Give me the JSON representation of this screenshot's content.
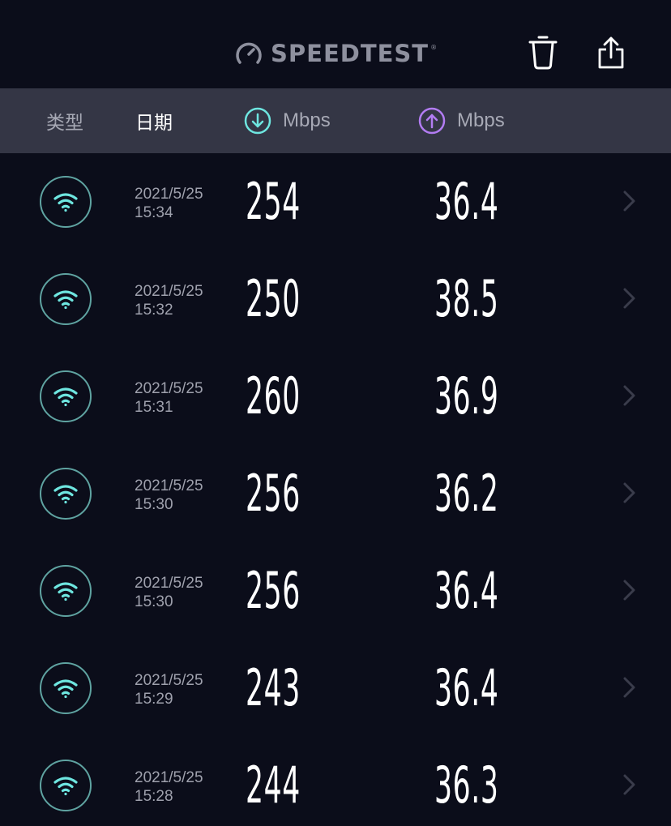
{
  "app": {
    "brand": "SPEEDTEST",
    "brand_tm": "®"
  },
  "header": {
    "type_label": "类型",
    "date_label": "日期",
    "download_unit": "Mbps",
    "upload_unit": "Mbps"
  },
  "icons": {
    "brand": "speedometer-icon",
    "trash": "trash-icon",
    "share": "share-icon",
    "download": "arrow-down-circle-icon",
    "upload": "arrow-up-circle-icon",
    "row_type": "wifi-icon",
    "row_chevron": "chevron-right-icon"
  },
  "colors": {
    "background": "#0b0d1a",
    "header_bg": "#343645",
    "download_accent": "#6ee6e0",
    "upload_accent": "#b27cf2",
    "wifi_circle": "#5fa3a1"
  },
  "results": [
    {
      "date": "2021/5/25",
      "time": "15:34",
      "download": "254",
      "upload": "36.4"
    },
    {
      "date": "2021/5/25",
      "time": "15:32",
      "download": "250",
      "upload": "38.5"
    },
    {
      "date": "2021/5/25",
      "time": "15:31",
      "download": "260",
      "upload": "36.9"
    },
    {
      "date": "2021/5/25",
      "time": "15:30",
      "download": "256",
      "upload": "36.2"
    },
    {
      "date": "2021/5/25",
      "time": "15:30",
      "download": "256",
      "upload": "36.4"
    },
    {
      "date": "2021/5/25",
      "time": "15:29",
      "download": "243",
      "upload": "36.4"
    },
    {
      "date": "2021/5/25",
      "time": "15:28",
      "download": "244",
      "upload": "36.3"
    }
  ]
}
